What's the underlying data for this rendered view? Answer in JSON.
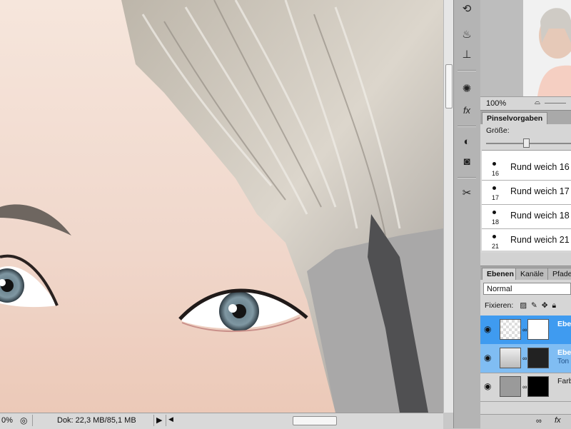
{
  "tools": [
    {
      "icon": "history-brush-icon"
    },
    {
      "icon": "clone-stamp-icon"
    },
    {
      "icon": "stamp-source-icon"
    },
    {
      "icon": "styles-palette-icon"
    },
    {
      "icon": "fx-icon"
    },
    {
      "icon": "adjustment-icon"
    },
    {
      "icon": "mask-icon"
    },
    {
      "icon": "tool-presets-icon"
    }
  ],
  "navigator": {
    "zoom": "100%"
  },
  "brush_panel": {
    "tab": "Pinselvorgaben",
    "size_label": "Größe:",
    "size_value": 0.5,
    "items": [
      {
        "num": "16",
        "name": "Rund weich 16"
      },
      {
        "num": "17",
        "name": "Rund weich 17"
      },
      {
        "num": "18",
        "name": "Rund weich 18"
      },
      {
        "num": "21",
        "name": "Rund weich 21"
      }
    ]
  },
  "layers_panel": {
    "tabs": [
      "Ebenen",
      "Kanäle",
      "Pfade"
    ],
    "blend_mode": "Normal",
    "lock_label": "Fixieren:",
    "layers": [
      {
        "name": "Ebene",
        "sub": "",
        "selected": true
      },
      {
        "name": "Ebene",
        "sub": "Ton",
        "selected": true
      },
      {
        "name": "Farb",
        "sub": "",
        "selected": false
      }
    ]
  },
  "status": {
    "zoom": "0%",
    "doc": "Dok: 22,3 MB/85,1 MB"
  },
  "colors": {
    "selection": "#3f9bf0",
    "panel_bg": "#d6d6d6",
    "skin": "#f2ddd3",
    "hair": "#c9c6c0"
  }
}
